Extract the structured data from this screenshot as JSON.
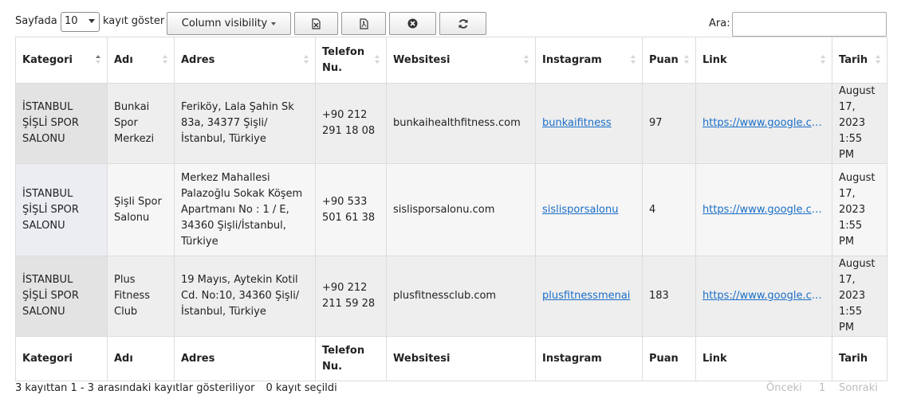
{
  "length_menu": {
    "prefix": "Sayfada",
    "selected": "10",
    "suffix": "kayıt göster"
  },
  "buttons": {
    "column_visibility": "Column visibility",
    "excel_icon": "file-excel-icon",
    "pdf_icon": "file-pdf-icon",
    "clear_icon": "close-circle-icon",
    "refresh_icon": "refresh-icon"
  },
  "search": {
    "label": "Ara:",
    "value": ""
  },
  "table": {
    "columns": [
      "Kategori",
      "Adı",
      "Adres",
      "Telefon Nu.",
      "Websitesi",
      "Instagram",
      "Puan",
      "Link",
      "Tarih"
    ],
    "rows": [
      {
        "kategori": "İSTANBUL ŞİŞLİ SPOR SALONU",
        "adi": "Bunkai Spor Merkezi",
        "adres": "Feriköy, Lala Şahin Sk 83a, 34377 Şişli/İstanbul, Türkiye",
        "telefon": "+90 212 291 18 08",
        "websitesi": "bunkaihealthfitness.com",
        "instagram": "bunkaifitness",
        "puan": "97",
        "link": "https://www.google.com/maps",
        "tarih": "August 17, 2023 1:55 PM"
      },
      {
        "kategori": "İSTANBUL ŞİŞLİ SPOR SALONU",
        "adi": "Şişli Spor Salonu",
        "adres": "Merkez Mahallesi Palazoğlu Sokak Köşem Apartmanı No : 1 / E, 34360 Şişli/İstanbul, Türkiye",
        "telefon": "+90 533 501 61 38",
        "websitesi": "sislisporsalonu.com",
        "instagram": "sislisporsalonu",
        "puan": "4",
        "link": "https://www.google.com/maps",
        "tarih": "August 17, 2023 1:55 PM"
      },
      {
        "kategori": "İSTANBUL ŞİŞLİ SPOR SALONU",
        "adi": "Plus Fitness Club",
        "adres": "19 Mayıs, Aytekin Kotil Cd. No:10, 34360 Şişli/İstanbul, Türkiye",
        "telefon": "+90 212 211 59 28",
        "websitesi": "plusfitnessclub.com",
        "instagram": "plusfitnessmenai",
        "puan": "183",
        "link": "https://www.google.com/maps",
        "tarih": "August 17, 2023 1:55 PM"
      }
    ]
  },
  "info": {
    "summary": "3 kayıttan 1 - 3 arasındaki kayıtlar gösteriliyor",
    "selected": "0 kayıt seçildi"
  },
  "pagination": {
    "previous": "Önceki",
    "page": "1",
    "next": "Sonraki"
  },
  "colors": {
    "link": "#1a6ec7",
    "row_odd": "#eeeeee",
    "row_even": "#f6f6f6",
    "disabled": "#bdbdbd"
  }
}
